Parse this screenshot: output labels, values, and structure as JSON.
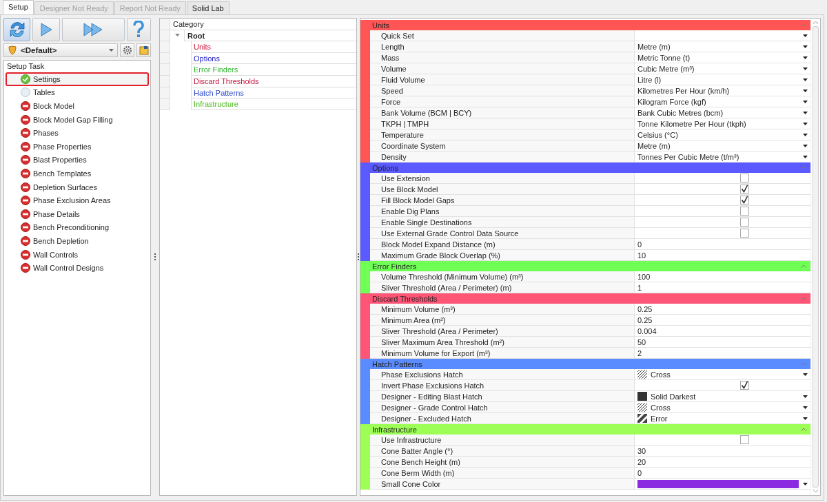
{
  "tabs": [
    {
      "label": "Setup",
      "selected": true,
      "disabled": false
    },
    {
      "label": "Designer Not Ready",
      "selected": false,
      "disabled": true
    },
    {
      "label": "Report Not Ready",
      "selected": false,
      "disabled": true
    },
    {
      "label": "Solid Lab",
      "selected": false,
      "disabled": false
    }
  ],
  "profile": {
    "value": "<Default>"
  },
  "setup_task": {
    "title": "Setup Task",
    "items": [
      {
        "label": "Settings",
        "kind": "done",
        "selected": true
      },
      {
        "label": "Tables",
        "kind": "none",
        "selected": false
      },
      {
        "label": "Block Model",
        "kind": "blocked",
        "selected": false
      },
      {
        "label": "Block Model Gap Filling",
        "kind": "blocked",
        "selected": false
      },
      {
        "label": "Phases",
        "kind": "blocked",
        "selected": false
      },
      {
        "label": "Phase Properties",
        "kind": "blocked",
        "selected": false
      },
      {
        "label": "Blast Properties",
        "kind": "blocked",
        "selected": false
      },
      {
        "label": "Bench Templates",
        "kind": "blocked",
        "selected": false
      },
      {
        "label": "Depletion Surfaces",
        "kind": "blocked",
        "selected": false
      },
      {
        "label": "Phase Exclusion Areas",
        "kind": "blocked",
        "selected": false
      },
      {
        "label": "Phase Details",
        "kind": "blocked",
        "selected": false
      },
      {
        "label": "Bench Preconditioning",
        "kind": "blocked",
        "selected": false
      },
      {
        "label": "Bench Depletion",
        "kind": "blocked",
        "selected": false
      },
      {
        "label": "Wall Controls",
        "kind": "blocked",
        "selected": false
      },
      {
        "label": "Wall Control Designs",
        "kind": "blocked",
        "selected": false
      }
    ]
  },
  "category": {
    "header": "Category",
    "root": {
      "label": "Root",
      "expanded": true,
      "children": [
        {
          "label": "Units",
          "color": "#d2143a"
        },
        {
          "label": "Options",
          "color": "#1a1ac8"
        },
        {
          "label": "Error Finders",
          "color": "#2fb52f"
        },
        {
          "label": "Discard Thresholds",
          "color": "#c0143c"
        },
        {
          "label": "Hatch Patterns",
          "color": "#2848c8"
        },
        {
          "label": "Infrastructure",
          "color": "#4cb51c"
        }
      ]
    }
  },
  "properties": {
    "sections": [
      {
        "title": "Units",
        "color": "#ff5555",
        "rows": [
          {
            "label": "Quick Set",
            "kind": "dropdown"
          },
          {
            "label": "Length",
            "kind": "dropdown",
            "value": "Metre (m)"
          },
          {
            "label": "Mass",
            "kind": "dropdown",
            "value": "Metric Tonne (t)"
          },
          {
            "label": "Volume",
            "kind": "dropdown",
            "value": "Cubic Metre (m³)"
          },
          {
            "label": "Fluid Volume",
            "kind": "dropdown",
            "value": "Litre (l)"
          },
          {
            "label": "Speed",
            "kind": "dropdown",
            "value": "Kilometres Per Hour (km/h)"
          },
          {
            "label": "Force",
            "kind": "dropdown",
            "value": "Kilogram Force (kgf)"
          },
          {
            "label": "Bank Volume (BCM | BCY)",
            "kind": "dropdown",
            "value": "Bank Cubic Metres (bcm)"
          },
          {
            "label": "TKPH | TMPH",
            "kind": "dropdown",
            "value": "Tonne Kilometre Per Hour (tkph)"
          },
          {
            "label": "Temperature",
            "kind": "dropdown",
            "value": "Celsius (°C)"
          },
          {
            "label": "Coordinate System",
            "kind": "dropdown",
            "value": "Metre (m)"
          },
          {
            "label": "Density",
            "kind": "dropdown",
            "value": "Tonnes Per Cubic Metre (t/m³)"
          }
        ]
      },
      {
        "title": "Options",
        "color": "#5a5aff",
        "rows": [
          {
            "label": "Use Extension",
            "kind": "checkbox",
            "checked": false
          },
          {
            "label": "Use Block Model",
            "kind": "checkbox",
            "checked": true
          },
          {
            "label": "Fill Block Model Gaps",
            "kind": "checkbox",
            "checked": true
          },
          {
            "label": "Enable Dig Plans",
            "kind": "checkbox",
            "checked": false
          },
          {
            "label": "Enable Single Destinations",
            "kind": "checkbox",
            "checked": false
          },
          {
            "label": "Use External Grade Control Data Source",
            "kind": "checkbox",
            "checked": false
          },
          {
            "label": "Block Model Expand Distance (m)",
            "kind": "text",
            "value": "0"
          },
          {
            "label": "Maximum Grade Block Overlap (%)",
            "kind": "text",
            "value": "10"
          }
        ]
      },
      {
        "title": "Error Finders",
        "color": "#70ff55",
        "rows": [
          {
            "label": "Volume Threshold (Minimum Volume) (m³)",
            "kind": "text",
            "value": "100"
          },
          {
            "label": "Sliver Threshold (Area / Perimeter) (m)",
            "kind": "text",
            "value": "1"
          }
        ]
      },
      {
        "title": "Discard Thresholds",
        "color": "#ff5577",
        "rows": [
          {
            "label": "Minimum Volume (m³)",
            "kind": "text",
            "value": "0.25"
          },
          {
            "label": "Minimum Area (m²)",
            "kind": "text",
            "value": "0.25"
          },
          {
            "label": "Sliver Threshold (Area / Perimeter)",
            "kind": "text",
            "value": "0.004"
          },
          {
            "label": "Sliver Maximum Area Threshold (m²)",
            "kind": "text",
            "value": "50"
          },
          {
            "label": "Minimum Volume for Export (m³)",
            "kind": "text",
            "value": "2"
          }
        ]
      },
      {
        "title": "Hatch Patterns",
        "color": "#5a8cff",
        "rows": [
          {
            "label": "Phase Exclusions Hatch",
            "kind": "crosshatch",
            "value": "Cross"
          },
          {
            "label": "Invert Phase Exclusions Hatch",
            "kind": "checkbox",
            "checked": true
          },
          {
            "label": "Designer - Editing Blast Hatch",
            "kind": "solidfill",
            "value": "Solid Darkest"
          },
          {
            "label": "Designer - Grade Control Hatch",
            "kind": "crosshatch",
            "value": "Cross"
          },
          {
            "label": "Designer - Excluded Hatch",
            "kind": "diagonal",
            "value": "Error"
          }
        ]
      },
      {
        "title": "Infrastructure",
        "color": "#9dff55",
        "rows": [
          {
            "label": "Use Infrastructure",
            "kind": "checkbox",
            "checked": false
          },
          {
            "label": "Cone Batter Angle (°)",
            "kind": "text",
            "value": "30"
          },
          {
            "label": "Cone Bench Height (m)",
            "kind": "text",
            "value": "20"
          },
          {
            "label": "Cone Berm Width (m)",
            "kind": "text",
            "value": "0"
          },
          {
            "label": "Small Cone Color",
            "kind": "color",
            "color": "#8a2be2"
          }
        ]
      }
    ]
  }
}
